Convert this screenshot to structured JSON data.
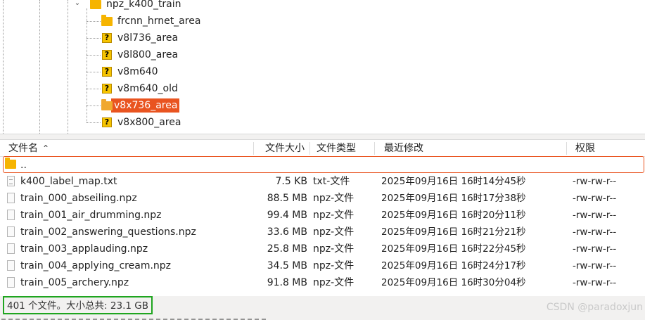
{
  "tree": {
    "root": {
      "label": "npz_k400_train",
      "icon": "folder-icon"
    },
    "children": [
      {
        "label": "frcnn_hrnet_area",
        "icon": "folder-icon",
        "selected": false
      },
      {
        "label": "v8l736_area",
        "icon": "unknown-icon",
        "selected": false
      },
      {
        "label": "v8l800_area",
        "icon": "unknown-icon",
        "selected": false
      },
      {
        "label": "v8m640",
        "icon": "unknown-icon",
        "selected": false
      },
      {
        "label": "v8m640_old",
        "icon": "unknown-icon",
        "selected": false
      },
      {
        "label": "v8x736_area",
        "icon": "folder-icon",
        "selected": true
      },
      {
        "label": "v8x800_area",
        "icon": "unknown-icon",
        "selected": false
      }
    ]
  },
  "list": {
    "columns": {
      "name": "文件名",
      "size": "文件大小",
      "type": "文件类型",
      "modified": "最近修改",
      "perm": "权限"
    },
    "parent_row": {
      "name": ".."
    },
    "rows": [
      {
        "name": "k400_label_map.txt",
        "size": "7.5 KB",
        "type": "txt-文件",
        "modified": "2025年09月16日 16时14分45秒",
        "perm": "-rw-rw-r--"
      },
      {
        "name": "train_000_abseiling.npz",
        "size": "88.5 MB",
        "type": "npz-文件",
        "modified": "2025年09月16日 16时17分38秒",
        "perm": "-rw-rw-r--"
      },
      {
        "name": "train_001_air_drumming.npz",
        "size": "99.4 MB",
        "type": "npz-文件",
        "modified": "2025年09月16日 16时20分11秒",
        "perm": "-rw-rw-r--"
      },
      {
        "name": "train_002_answering_questions.npz",
        "size": "33.6 MB",
        "type": "npz-文件",
        "modified": "2025年09月16日 16时21分21秒",
        "perm": "-rw-rw-r--"
      },
      {
        "name": "train_003_applauding.npz",
        "size": "25.8 MB",
        "type": "npz-文件",
        "modified": "2025年09月16日 16时22分45秒",
        "perm": "-rw-rw-r--"
      },
      {
        "name": "train_004_applying_cream.npz",
        "size": "34.5 MB",
        "type": "npz-文件",
        "modified": "2025年09月16日 16时24分17秒",
        "perm": "-rw-rw-r--"
      },
      {
        "name": "train_005_archery.npz",
        "size": "91.8 MB",
        "type": "npz-文件",
        "modified": "2025年09月16日 16时30分04秒",
        "perm": "-rw-rw-r--"
      }
    ]
  },
  "status": {
    "text": "401 个文件。大小总共: 23.1 GB"
  },
  "watermark": "CSDN @paradoxjun",
  "colors": {
    "selection": "#e95420",
    "folder": "#f6b400",
    "status_border": "#1fa51f"
  }
}
